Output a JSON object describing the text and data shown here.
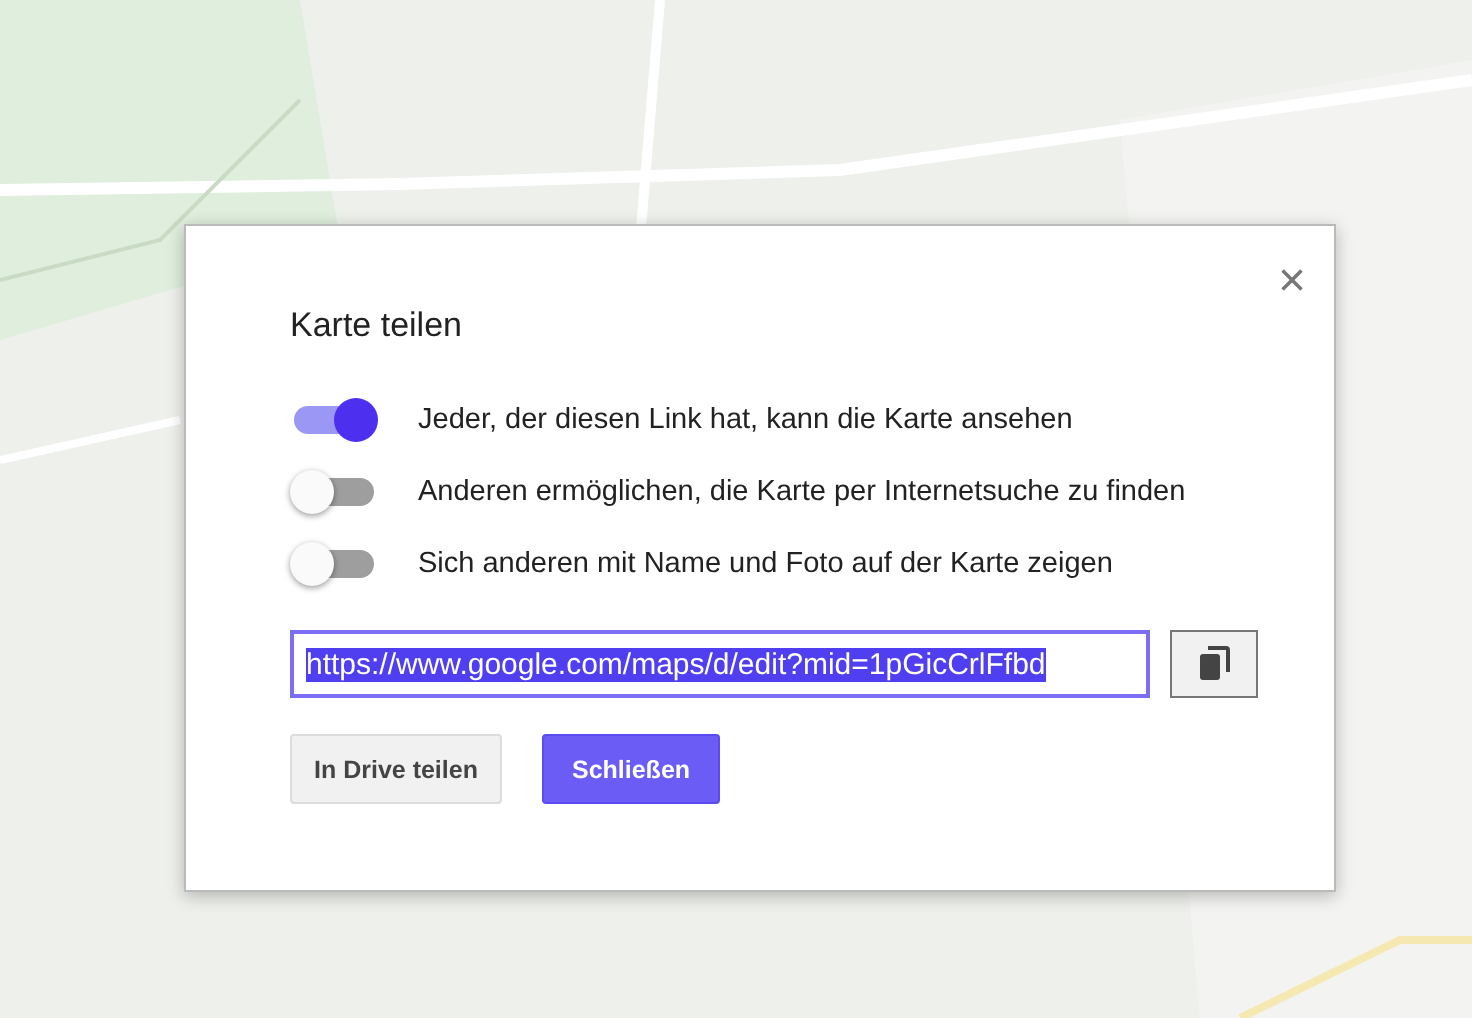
{
  "dialog": {
    "title": "Karte teilen",
    "close_icon": "×",
    "options": [
      {
        "label": "Jeder, der diesen Link hat, kann die Karte ansehen",
        "on": true
      },
      {
        "label": "Anderen ermöglichen, die Karte per Internetsuche zu finden",
        "on": false
      },
      {
        "label": "Sich anderen mit Name und Foto auf der Karte zeigen",
        "on": false
      }
    ],
    "link": {
      "value": "https://www.google.com/maps/d/edit?mid=1pGicCrlFfbd",
      "text_selected": true
    },
    "buttons": [
      {
        "label": "In Drive teilen",
        "kind": "secondary"
      },
      {
        "label": "Schließen",
        "kind": "primary"
      }
    ]
  }
}
